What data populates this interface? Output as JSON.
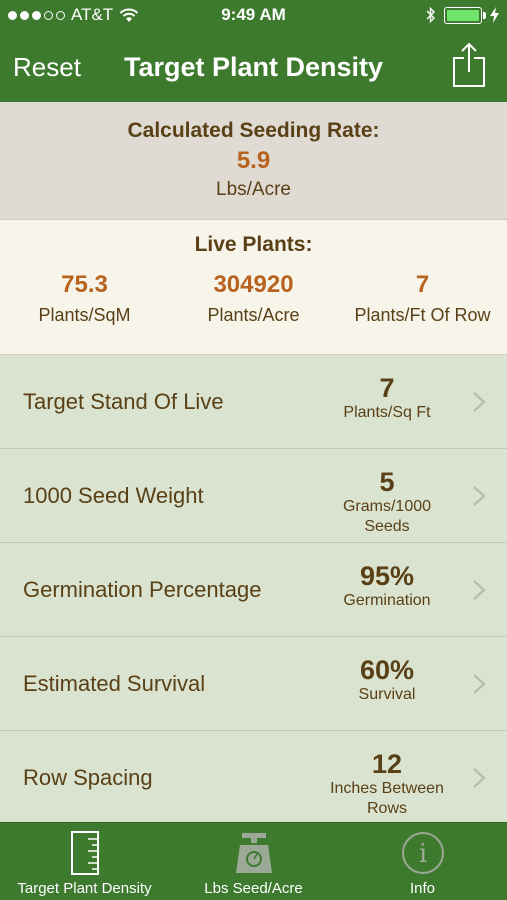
{
  "status": {
    "carrier": "AT&T",
    "time": "9:49 AM",
    "signal_dots_filled": 3,
    "signal_dots_total": 5
  },
  "nav": {
    "reset_label": "Reset",
    "title": "Target Plant Density",
    "share_icon": "share-icon"
  },
  "seeding": {
    "label": "Calculated Seeding Rate:",
    "value": "5.9",
    "unit": "Lbs/Acre"
  },
  "live": {
    "label": "Live Plants:",
    "columns": [
      {
        "value": "75.3",
        "unit": "Plants/SqM"
      },
      {
        "value": "304920",
        "unit": "Plants/Acre"
      },
      {
        "value": "7",
        "unit": "Plants/Ft Of Row"
      }
    ]
  },
  "rows": [
    {
      "name": "Target Stand Of Live",
      "value": "7",
      "unit": [
        "Plants/Sq Ft"
      ]
    },
    {
      "name": "1000 Seed Weight",
      "value": "5",
      "unit": [
        "Grams/1000",
        "Seeds"
      ]
    },
    {
      "name": "Germination Percentage",
      "value": "95%",
      "unit": [
        "Germination"
      ]
    },
    {
      "name": "Estimated Survival",
      "value": "60%",
      "unit": [
        "Survival"
      ]
    },
    {
      "name": "Row Spacing",
      "value": "12",
      "unit": [
        "Inches Between",
        "Rows"
      ]
    }
  ],
  "tabs": [
    {
      "label": "Target Plant Density",
      "icon": "ruler-icon"
    },
    {
      "label": "Lbs Seed/Acre",
      "icon": "scale-icon"
    },
    {
      "label": "Info",
      "icon": "info-icon"
    }
  ],
  "colors": {
    "bar_green": "#3d7a2e",
    "value_orange": "#b8621f",
    "text_brown": "#5a4016",
    "row_bg": "#d9e3cf"
  }
}
